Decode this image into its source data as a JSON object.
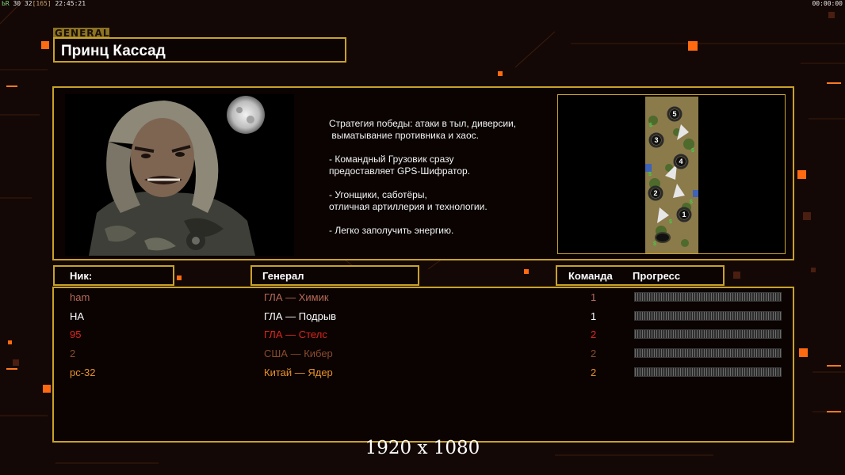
{
  "hud": {
    "left_fps": "ЬR",
    "left_nums": "30 32",
    "left_bracket": "[165]",
    "left_time": "22:45:21",
    "right_time": "00:00:00"
  },
  "general_tag": "GENERAL",
  "general_name": "Принц Кассад",
  "description": {
    "lines": [
      "Стратегия победы: атаки в тыл, диверсии,",
      " выматывание противника и хаос.",
      "",
      "- Командный Грузовик сразу",
      "предоставляет GPS-Шифратор.",
      "",
      "- Угонщики, саботёры,",
      "отличная артиллерия и технологии.",
      "",
      "- Легко заполучить энергию."
    ]
  },
  "minimap": {
    "start_positions": [
      "5",
      "3",
      "4",
      "2",
      "1"
    ]
  },
  "columns": {
    "nick": "Ник:",
    "general": "Генерал",
    "team": "Команда",
    "progress": "Прогресс"
  },
  "players": [
    {
      "nick": "ham",
      "general": "ГЛА — Химик",
      "team": "1",
      "color": "#b86a56"
    },
    {
      "nick": "HA",
      "general": "ГЛА — Подрыв",
      "team": "1",
      "color": "#ffffff"
    },
    {
      "nick": "95",
      "general": "ГЛА — Стелс",
      "team": "2",
      "color": "#e0241c"
    },
    {
      "nick": "2",
      "general": "США — Кибер",
      "team": "2",
      "color": "#8a4a2c"
    },
    {
      "nick": "pc-32",
      "general": "Китай — Ядер",
      "team": "2",
      "color": "#e8912a"
    }
  ],
  "resolution_caption": "1920 x 1080",
  "colors": {
    "accent": "#c9a12a",
    "background": "#140806"
  }
}
